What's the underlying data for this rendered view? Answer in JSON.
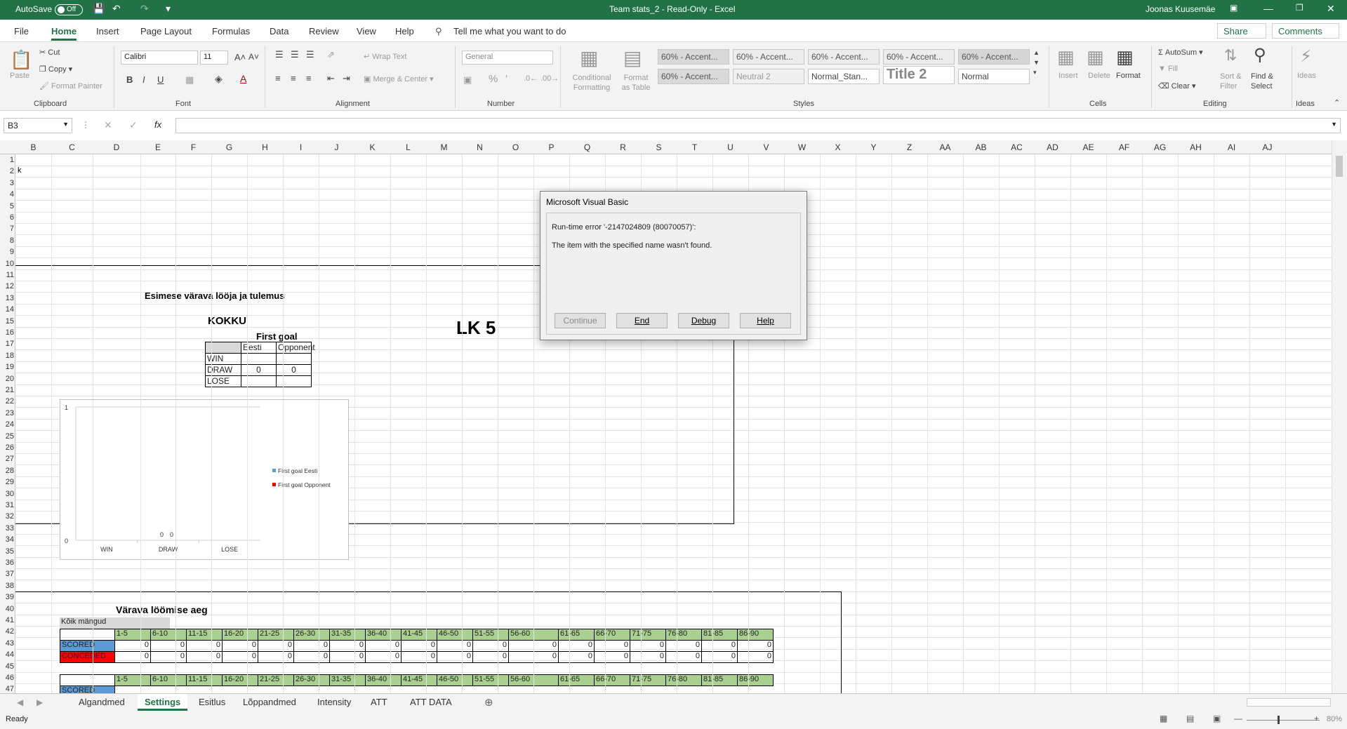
{
  "titlebar": {
    "autosave_label": "AutoSave",
    "toggle_state": "Off",
    "doc_title": "Team stats_2 - Read-Only - Excel",
    "user_name": "Joonas Kuusemäe",
    "bg_color": "#217346"
  },
  "menu": {
    "items": [
      "File",
      "Home",
      "Insert",
      "Page Layout",
      "Formulas",
      "Data",
      "Review",
      "View",
      "Help"
    ],
    "tell_me": "Tell me what you want to do",
    "share": "Share",
    "comments": "Comments"
  },
  "ribbon": {
    "clipboard": {
      "paste": "Paste",
      "cut": "Cut",
      "copy": "Copy",
      "format_painter": "Format Painter",
      "label": "Clipboard"
    },
    "font": {
      "name": "Calibri",
      "size": "11",
      "label": "Font",
      "bold": "B",
      "italic": "I",
      "underline": "U"
    },
    "alignment": {
      "wrap": "Wrap Text",
      "merge": "Merge & Center",
      "label": "Alignment"
    },
    "number": {
      "format": "General",
      "label": "Number",
      "percent": "%"
    },
    "styles": {
      "conditional": "Conditional Formatting",
      "format_table": "Format as Table",
      "cells": [
        "60% - Accent...",
        "60% - Accent...",
        "60% - Accent...",
        "60% - Accent...",
        "60% - Accent...",
        "60% - Accent...",
        "Neutral 2",
        "Normal_Stan...",
        "Title 2",
        "Normal"
      ],
      "label": "Styles"
    },
    "cells": {
      "insert": "Insert",
      "delete": "Delete",
      "format": "Format",
      "label": "Cells"
    },
    "editing": {
      "autosum": "AutoSum",
      "fill": "Fill",
      "clear": "Clear",
      "sort": "Sort & Filter",
      "find": "Find & Select",
      "label": "Editing"
    },
    "ideas": {
      "ideas": "Ideas",
      "label": "Ideas"
    }
  },
  "formula_bar": {
    "name_box": "B3",
    "fx": "fx",
    "value": ""
  },
  "columns": [
    "B",
    "C",
    "D",
    "E",
    "F",
    "G",
    "H",
    "I",
    "J",
    "K",
    "L",
    "M",
    "N",
    "O",
    "P",
    "Q",
    "R",
    "S",
    "T",
    "U",
    "V",
    "W",
    "X",
    "Y",
    "Z",
    "AA",
    "AB",
    "AC",
    "AD",
    "AE",
    "AF",
    "AG",
    "AH",
    "AI",
    "AJ"
  ],
  "rows": [
    "1",
    "2",
    "3",
    "4",
    "5",
    "6",
    "7",
    "8",
    "9",
    "10",
    "11",
    "12",
    "13",
    "14",
    "15",
    "16",
    "17",
    "18",
    "19",
    "20",
    "21",
    "22",
    "23",
    "24",
    "25",
    "26",
    "27",
    "28",
    "29",
    "30",
    "31",
    "32",
    "33",
    "34",
    "35",
    "36",
    "37",
    "38",
    "39",
    "40",
    "41",
    "42",
    "43",
    "44",
    "45",
    "46",
    "47"
  ],
  "sheet": {
    "b2": "k",
    "heading1": "Esimese värava lööja ja tulemus",
    "kokku": "KOKKU",
    "lk5": "LK 5",
    "first_goal": "First goal",
    "eesti": "Eesti",
    "opponent": "Opponent",
    "win": "WIN",
    "draw": "DRAW",
    "lose": "LOSE",
    "draw_eesti": "0",
    "draw_opp": "0",
    "heading2": "Värava löömise aeg",
    "koik": "Kõik mängud",
    "intervals": [
      "1-5",
      "6-10",
      "11-15",
      "16-20",
      "21-25",
      "26-30",
      "31-35",
      "36-40",
      "41-45",
      "46-50",
      "51-55",
      "56-60",
      "61-65",
      "66-70",
      "71-75",
      "76-80",
      "81-85",
      "86-90"
    ],
    "scored": "SCORED",
    "conceded": "CONCEDED",
    "zero": "0"
  },
  "chart_data": {
    "type": "bar",
    "categories": [
      "WIN",
      "DRAW",
      "LOSE"
    ],
    "series": [
      {
        "name": "First goal Eesti",
        "values": [
          null,
          0,
          null
        ],
        "color": "#5b9bd5"
      },
      {
        "name": "First goal Opponent",
        "values": [
          null,
          0,
          null
        ],
        "color": "#ff0000"
      }
    ],
    "ylim": [
      0,
      1
    ],
    "y_ticks": [
      "0",
      "1"
    ],
    "data_labels": [
      "0",
      "0"
    ],
    "legend": "right"
  },
  "dialog": {
    "title": "Microsoft Visual Basic",
    "error": "Run-time error '-2147024809 (80070057)':",
    "message": "The item with the specified name wasn't found.",
    "buttons": {
      "continue": "Continue",
      "end": "End",
      "debug": "Debug",
      "help": "Help"
    }
  },
  "tabs": [
    "Algandmed",
    "Settings",
    "Esitlus",
    "Lõppandmed",
    "Intensity",
    "ATT",
    "ATT DATA"
  ],
  "status": {
    "ready": "Ready",
    "zoom": "80%"
  }
}
